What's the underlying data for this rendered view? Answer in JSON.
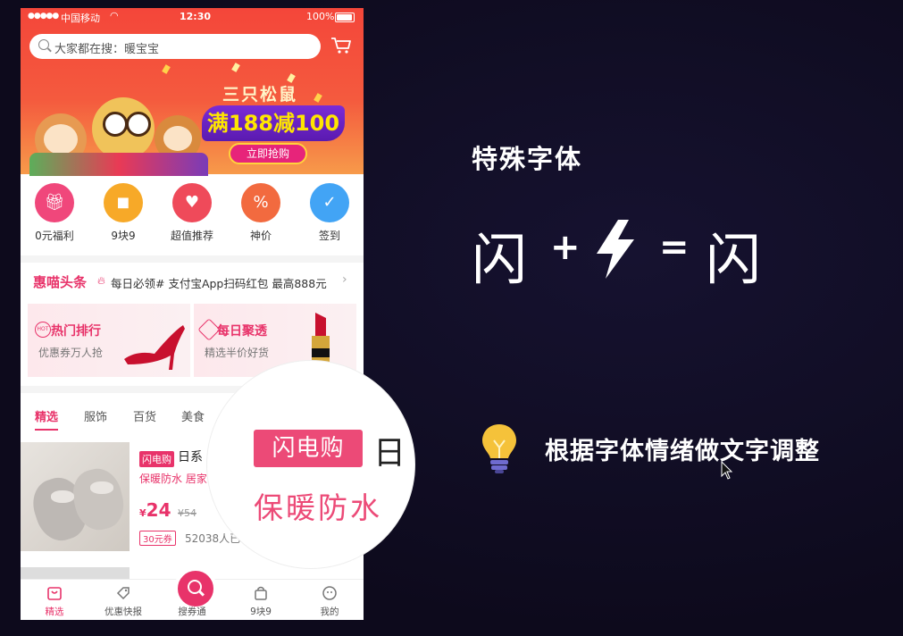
{
  "status_bar": {
    "carrier": "中国移动",
    "time": "12:30",
    "battery": "100%"
  },
  "search": {
    "placeholder": "大家都在搜：暖宝宝"
  },
  "banner": {
    "brand": "三只松鼠",
    "promo": "满188减100",
    "cta": "立即抢购"
  },
  "nav_items": [
    {
      "label": "0元福利",
      "icon": "gift-icon",
      "color": "#f0477b"
    },
    {
      "label": "9块9",
      "icon": "bag-icon",
      "color": "#f7a928"
    },
    {
      "label": "超值推荐",
      "icon": "heart-icon",
      "color": "#ef4a5a"
    },
    {
      "label": "神价",
      "icon": "percent-icon",
      "color": "#f26a3f"
    },
    {
      "label": "签到",
      "icon": "calendar-check-icon",
      "color": "#42a4f5"
    }
  ],
  "news": {
    "brand": "惠喵头条",
    "text": "每日必领# 支付宝App扫码红包 最高888元"
  },
  "cards": [
    {
      "title": "热门排行",
      "subtitle": "优惠券万人抢",
      "badge": "HOT"
    },
    {
      "title": "每日聚透",
      "subtitle": "精选半价好货"
    }
  ],
  "tabs": [
    "精选",
    "服饰",
    "百货",
    "美食"
  ],
  "product": {
    "tag": "闪电购",
    "name": "日系",
    "keyword": "保暖防水",
    "keyword_extra": "居家",
    "price_symbol": "¥",
    "price": "24",
    "original_price": "¥54",
    "coupon": "30元券",
    "sold": "52038人已"
  },
  "tabbar": [
    "精选",
    "优惠快报",
    "搜券通",
    "9块9",
    "我的"
  ],
  "zoom": {
    "tag": "闪电购",
    "next_char": "日",
    "keyword": "保暖防水"
  },
  "slide": {
    "headline": "特殊字体",
    "eq_left": "闪",
    "plus": "+",
    "equals": "=",
    "eq_right": "闪",
    "tip": "根据字体情绪做文字调整"
  },
  "colors": {
    "accent": "#e8336a",
    "slide_bg": "#0e0b1f"
  }
}
